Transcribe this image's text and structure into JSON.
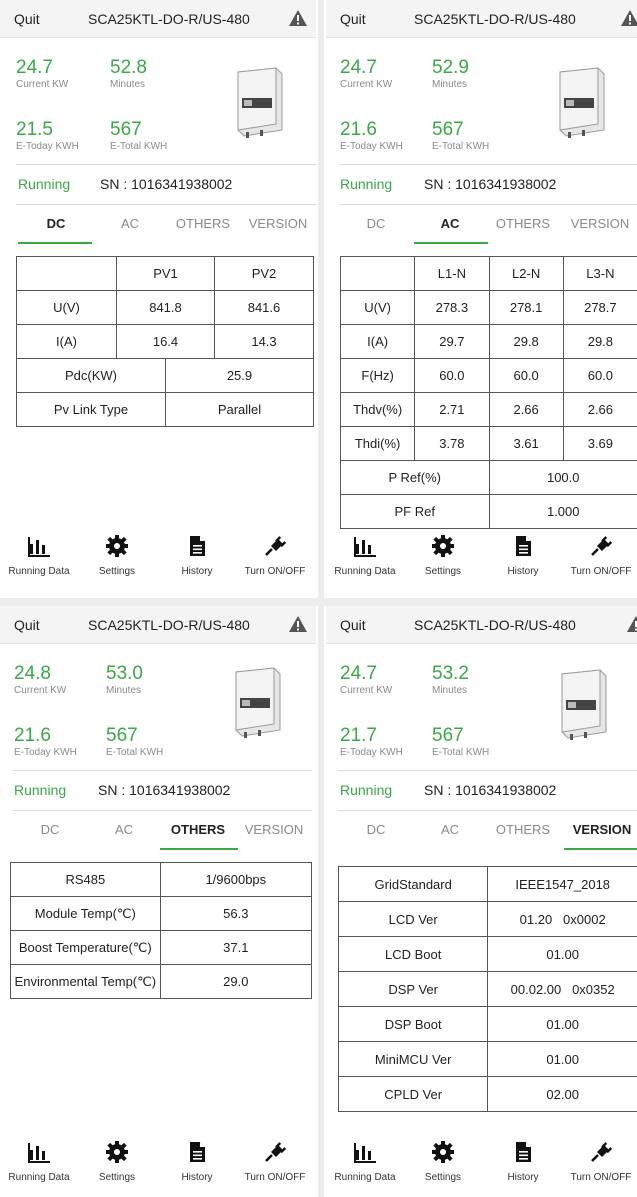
{
  "panels": [
    {
      "topbar": {
        "quit": "Quit",
        "model": "SCA25KTL-DO-R/US-480"
      },
      "stats": {
        "current_kw": {
          "value": "24.7",
          "label": "Current KW"
        },
        "minutes": {
          "value": "52.8",
          "label": "Minutes"
        },
        "e_today": {
          "value": "21.5",
          "label": "E-Today KWH"
        },
        "e_total": {
          "value": "567",
          "label": "E-Total KWH"
        }
      },
      "status": "Running",
      "sn": "SN : 1016341938002",
      "tabs": [
        "DC",
        "AC",
        "OTHERS",
        "VERSION"
      ],
      "active_tab": "DC",
      "table": {
        "headers": [
          "",
          "PV1",
          "PV2"
        ],
        "rows": [
          [
            "U(V)",
            "841.8",
            "841.6"
          ],
          [
            "I(A)",
            "16.4",
            "14.3"
          ]
        ],
        "merged_rows": [
          [
            "Pdc(KW)",
            "25.9"
          ],
          [
            "Pv Link Type",
            "Parallel"
          ]
        ]
      },
      "nav": [
        "Running Data",
        "Settings",
        "History",
        "Turn ON/OFF"
      ]
    },
    {
      "topbar": {
        "quit": "Quit",
        "model": "SCA25KTL-DO-R/US-480"
      },
      "stats": {
        "current_kw": {
          "value": "24.7",
          "label": "Current KW"
        },
        "minutes": {
          "value": "52.9",
          "label": "Minutes"
        },
        "e_today": {
          "value": "21.6",
          "label": "E-Today KWH"
        },
        "e_total": {
          "value": "567",
          "label": "E-Total KWH"
        }
      },
      "status": "Running",
      "sn": "SN : 1016341938002",
      "tabs": [
        "DC",
        "AC",
        "OTHERS",
        "VERSION"
      ],
      "active_tab": "AC",
      "table": {
        "headers": [
          "",
          "L1-N",
          "L2-N",
          "L3-N"
        ],
        "rows": [
          [
            "U(V)",
            "278.3",
            "278.1",
            "278.7"
          ],
          [
            "I(A)",
            "29.7",
            "29.8",
            "29.8"
          ],
          [
            "F(Hz)",
            "60.0",
            "60.0",
            "60.0"
          ],
          [
            "Thdv(%)",
            "2.71",
            "2.66",
            "2.66"
          ],
          [
            "Thdi(%)",
            "3.78",
            "3.61",
            "3.69"
          ]
        ],
        "merged_rows": [
          [
            "P Ref(%)",
            "100.0"
          ],
          [
            "PF Ref",
            "1.000"
          ]
        ]
      },
      "nav": [
        "Running Data",
        "Settings",
        "History",
        "Turn ON/OFF"
      ]
    },
    {
      "topbar": {
        "quit": "Quit",
        "model": "SCA25KTL-DO-R/US-480"
      },
      "stats": {
        "current_kw": {
          "value": "24.8",
          "label": "Current KW"
        },
        "minutes": {
          "value": "53.0",
          "label": "Minutes"
        },
        "e_today": {
          "value": "21.6",
          "label": "E-Today KWH"
        },
        "e_total": {
          "value": "567",
          "label": "E-Total KWH"
        }
      },
      "status": "Running",
      "sn": "SN : 1016341938002",
      "tabs": [
        "DC",
        "AC",
        "OTHERS",
        "VERSION"
      ],
      "active_tab": "OTHERS",
      "table": {
        "rows": [
          [
            "RS485",
            "1/9600bps"
          ],
          [
            "Module Temp(℃)",
            "56.3"
          ],
          [
            "Boost Temperature(℃)",
            "37.1"
          ],
          [
            "Environmental Temp(℃)",
            "29.0"
          ]
        ]
      },
      "nav": [
        "Running Data",
        "Settings",
        "History",
        "Turn ON/OFF"
      ]
    },
    {
      "topbar": {
        "quit": "Quit",
        "model": "SCA25KTL-DO-R/US-480"
      },
      "stats": {
        "current_kw": {
          "value": "24.7",
          "label": "Current KW"
        },
        "minutes": {
          "value": "53.2",
          "label": "Minutes"
        },
        "e_today": {
          "value": "21.7",
          "label": "E-Today KWH"
        },
        "e_total": {
          "value": "567",
          "label": "E-Total KWH"
        }
      },
      "status": "Running",
      "sn": "SN : 1016341938002",
      "tabs": [
        "DC",
        "AC",
        "OTHERS",
        "VERSION"
      ],
      "active_tab": "VERSION",
      "table": {
        "rows": [
          [
            "GridStandard",
            "IEEE1547_2018"
          ],
          [
            "LCD Ver",
            "01.20   0x0002"
          ],
          [
            "LCD Boot",
            "01.00"
          ],
          [
            "DSP Ver",
            "00.02.00   0x0352"
          ],
          [
            "DSP Boot",
            "01.00"
          ],
          [
            "MiniMCU Ver",
            "01.00"
          ],
          [
            "CPLD Ver",
            "02.00"
          ]
        ]
      },
      "nav": [
        "Running Data",
        "Settings",
        "History",
        "Turn ON/OFF"
      ]
    }
  ],
  "colors": {
    "accent": "#3aa845",
    "muted": "#8a8a8a",
    "text": "#222222"
  },
  "icons": [
    "warning-icon",
    "bar-chart-icon",
    "gear-icon",
    "document-icon",
    "plug-icon"
  ]
}
